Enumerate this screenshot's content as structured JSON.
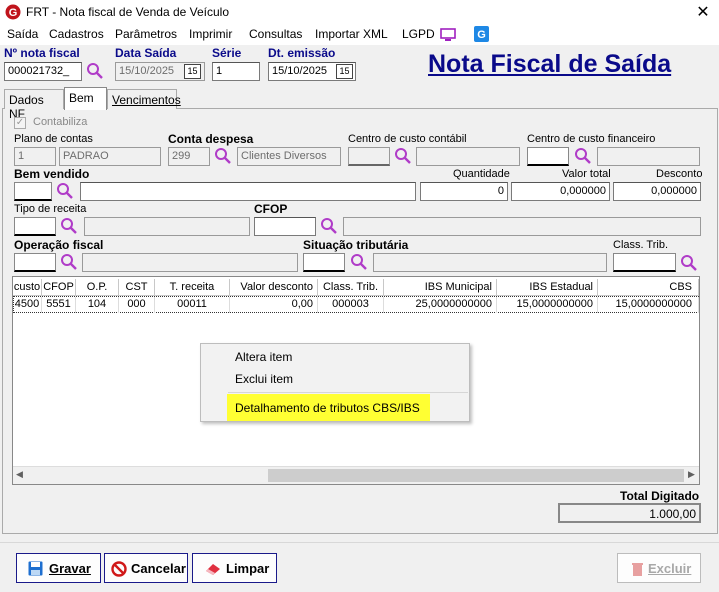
{
  "window": {
    "title": "FRT - Nota fiscal de Venda de Veículo",
    "close_glyph": "✕"
  },
  "menu": [
    "Saída",
    "Cadastros",
    "Parâmetros",
    "Imprimir",
    "Consultas",
    "Importar XML",
    "LGPD"
  ],
  "header": {
    "nota_label": "Nº nota fiscal",
    "nota_value": "000021732_",
    "data_saida_label": "Data Saída",
    "data_saida_value": "15/10/2025",
    "serie_label": "Série",
    "serie_value": "1",
    "dt_emissao_label": "Dt. emissão",
    "dt_emissao_value": "15/10/2025",
    "cal_glyph": "15",
    "big_title": "Nota Fiscal de Saída"
  },
  "tabs": [
    "Dados NF",
    "Bem",
    "Vencimentos"
  ],
  "form": {
    "contabiliza": "Contabiliza",
    "plano_label": "Plano de contas",
    "plano_code": "1",
    "plano_name": "PADRAO",
    "conta_label": "Conta despesa",
    "conta_code": "299",
    "conta_name": "Clientes Diversos",
    "cc_contabil_label": "Centro de custo contábil",
    "cc_financeiro_label": "Centro de custo financeiro",
    "bem_label": "Bem vendido",
    "quantidade_label": "Quantidade",
    "quantidade_value": "0",
    "valor_total_label": "Valor total",
    "valor_total_value": "0,000000",
    "desconto_label": "Desconto",
    "desconto_value": "0,000000",
    "tipo_receita_label": "Tipo de receita",
    "cfop_label": "CFOP",
    "operacao_label": "Operação fiscal",
    "situacao_label": "Situação tributária",
    "class_trib_label": "Class. Trib."
  },
  "grid": {
    "headers": [
      "custo",
      "CFOP",
      "O.P.",
      "CST",
      "T. receita",
      "Valor desconto",
      "Class. Trib.",
      "IBS Municipal",
      "IBS Estadual",
      "CBS"
    ],
    "row": [
      "4500",
      "5551",
      "104",
      "000",
      "00011",
      "0,00",
      "000003",
      "25,0000000000",
      "15,0000000000",
      "15,0000000000"
    ]
  },
  "context_menu": [
    "Altera item",
    "Exclui item",
    "Detalhamento de tributos CBS/IBS"
  ],
  "totals": {
    "label": "Total Digitado",
    "value": "1.000,00"
  },
  "buttons": {
    "gravar": "Gravar",
    "cancelar": "Cancelar",
    "limpar": "Limpar",
    "excluir": "Excluir"
  },
  "colors": {
    "accent": "#0a0a8a",
    "highlight": "#ffff33",
    "magnifier": "#b03cc8"
  }
}
